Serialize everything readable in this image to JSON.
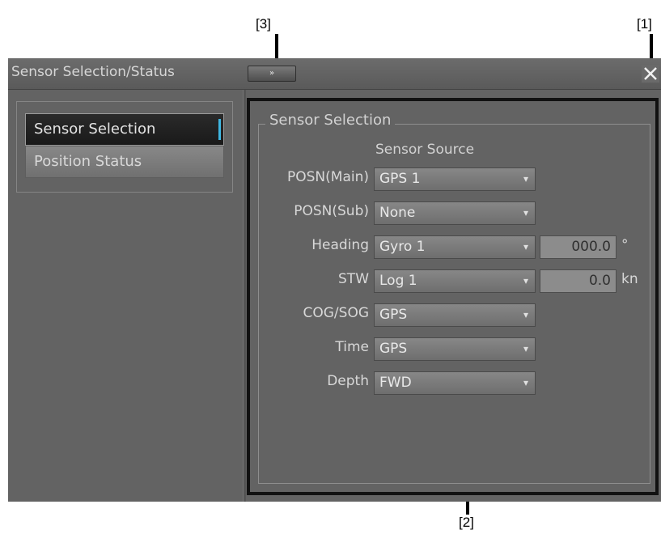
{
  "callouts": {
    "close": "[1]",
    "panel": "[2]",
    "expand": "[3]"
  },
  "window": {
    "title": "Sensor Selection/Status",
    "expand_label": "»",
    "close_icon": "close-icon"
  },
  "nav": {
    "items": [
      {
        "label": "Sensor Selection",
        "active": true
      },
      {
        "label": "Position Status",
        "active": false
      }
    ]
  },
  "panel": {
    "group_title": "Sensor Selection",
    "source_header": "Sensor Source",
    "rows": [
      {
        "label": "POSN(Main)",
        "value": "GPS 1"
      },
      {
        "label": "POSN(Sub)",
        "value": "None"
      },
      {
        "label": "Heading",
        "value": "Gyro 1",
        "readout": "000.0",
        "unit": "°"
      },
      {
        "label": "STW",
        "value": "Log 1",
        "readout": "0.0",
        "unit": "kn"
      },
      {
        "label": "COG/SOG",
        "value": "GPS"
      },
      {
        "label": "Time",
        "value": "GPS"
      },
      {
        "label": "Depth",
        "value": "FWD"
      }
    ]
  },
  "colors": {
    "window_bg": "#636363",
    "active_marker": "#3fb6e0",
    "panel_border": "#111111"
  }
}
